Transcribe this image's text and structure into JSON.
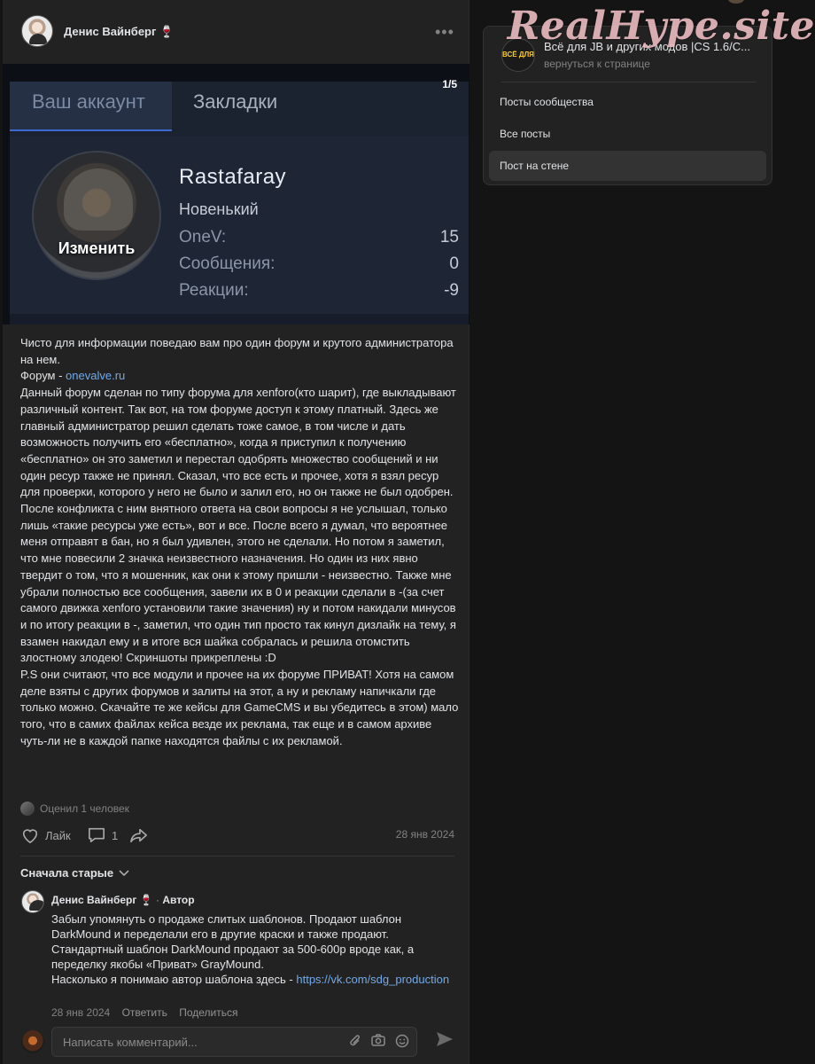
{
  "watermark": "RealHype.site",
  "post": {
    "author": "Денис Вайнберг 🍷",
    "more_icon": "more-horizontal-icon",
    "carousel": {
      "pager": "1/5",
      "tab_account": "Ваш аккаунт",
      "tab_bookmarks": "Закладки",
      "avatar_label": "Изменить",
      "username": "Rastafaray",
      "rank": "Новенький",
      "stats": [
        {
          "label": "OneV:",
          "value": "15"
        },
        {
          "label": "Сообщения:",
          "value": "0"
        },
        {
          "label": "Реакции:",
          "value": "-9"
        }
      ]
    },
    "text_intro": "Чисто для информации поведаю вам про один форум и крутого администратора на нем.\nФорум - ",
    "forum_link": "onevalve.ru",
    "text_body": "\nДанный форум сделан по типу форума для xenforo(кто шарит), где выкладывают различный контент. Так вот, на том форуме доступ к этому платный. Здесь же главный администратор решил сделать тоже самое, в том числе и дать возможность получить его «бесплатно», когда я приступил к получению «бесплатно» он это заметил и перестал одобрять множество сообщений и ни один ресур также не принял. Сказал, что все есть и прочее, хотя я взял ресур для проверки, которого у него не было и залил его, но он также не был одобрен. После конфликта с ним внятного ответа на свои вопросы я не услышал, только лишь «такие ресурсы уже есть», вот и все. После всего я думал, что вероятнее меня отправят в бан, но я был удивлен, этого не сделали. Но потом я заметил, что мне повесили 2 значка неизвестного назначения. Но один из них явно твердит о том, что я мошенник, как они к этому пришли - неизвестно. Также мне убрали полностью все сообщения, завели их в 0 и реакции сделали в -(за счет самого движка xenforo установили такие значения) ну и потом накидали минусов и по итогу реакции в -, заметил, что один тип просто так кинул дизлайк на тему, я взамен накидал ему и в итоге вся шайка собралась и решила отомстить злостному злодею! Скриншоты прикреплены :D\nP.S они считают, что все модули и прочее на их форуме ПРИВАТ! Хотя на самом деле взяты с других форумов и залиты на этот, а ну и рекламу напичкали где только можно. Скачайте те же кейсы для GameCMS и вы убедитесь в этом) мало того, что в самих файлах кейса везде их реклама, так еще и в самом архиве чуть-ли не в каждой папке находятся файлы с их рекламой.",
    "rated": "Оценил 1 человек",
    "like_label": "Лайк",
    "comments_count": "1",
    "date": "28 янв 2024"
  },
  "comments": {
    "sort_label": "Сначала старые",
    "items": [
      {
        "author": "Денис Вайнберг 🍷",
        "separator": " · ",
        "badge": "Автор",
        "text": "Забыл упомянуть о продаже слитых шаблонов. Продают шаблон DarkMound и переделали его в другие краски и также продают. Стандартный шаблон DarkMound продают за 500-600р вроде как, а переделку якобы «Приват» GrayMound.\nНасколько я понимаю автор шаблона здесь - ",
        "link": "https://vk.com/sdg_production",
        "date": "28 янв 2024",
        "reply": "Ответить",
        "share": "Поделиться"
      }
    ],
    "composer_placeholder": "Написать комментарий..."
  },
  "sidebar": {
    "group_logo_text": "ВСЁ ДЛЯ",
    "group_title": "Всё для JB и других модов |CS 1.6/C...",
    "back_label": "вернуться к странице",
    "items": [
      {
        "label": "Посты сообщества",
        "active": false
      },
      {
        "label": "Все посты",
        "active": false
      },
      {
        "label": "Пост на стене",
        "active": true
      }
    ]
  },
  "colors": {
    "background": "#141414",
    "card": "#222222",
    "link": "#71aaeb",
    "text": "#e1e3e6",
    "muted": "#828282"
  }
}
